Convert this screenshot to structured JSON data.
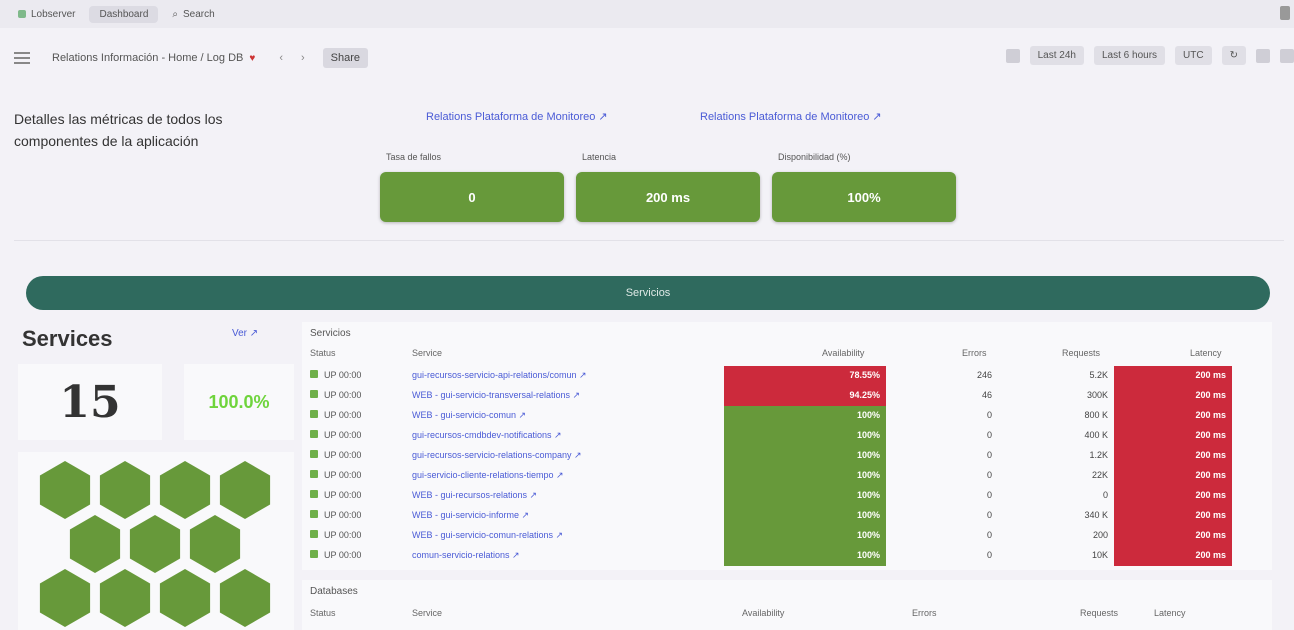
{
  "tabs": [
    {
      "label": "Lobserver",
      "active": false
    },
    {
      "label": "Dashboard",
      "active": true
    },
    {
      "label": "Search",
      "active": false
    }
  ],
  "toolbar": {
    "breadcrumb": "Relations Información - Home / Log DB",
    "favorite": "♥",
    "nav1": "‹",
    "nav2": "›",
    "button": "Share",
    "right_buttons": [
      "Last 24h",
      "Last 6 hours",
      "UTC",
      "↻"
    ]
  },
  "description": "Detalles las métricas de todos los componentes de la aplicación",
  "links": [
    "Relations Plataforma de Monitoreo ↗",
    "Relations Plataforma de Monitoreo ↗"
  ],
  "stats": [
    {
      "label": "Tasa de fallos",
      "value": "0"
    },
    {
      "label": "Latencia",
      "value": "200 ms"
    },
    {
      "label": "Disponibilidad (%)",
      "value": "100%"
    }
  ],
  "banner": "Servicios",
  "services": {
    "title": "Services",
    "link": "Ver ↗",
    "count": "15",
    "percent": "100.0%",
    "hex_count": 11
  },
  "table": {
    "title": "Servicios",
    "headers": [
      "Status",
      "Service",
      "Availability",
      "Errors",
      "Requests",
      "Latency"
    ],
    "rows": [
      {
        "status": "UP 00:00",
        "service": "gui-recursos-servicio-api-relations/comun ↗",
        "availability": "78.55%",
        "avail_color": "#cc2a3c",
        "errors": "246",
        "requests": "5.2K",
        "latency": "200 ms"
      },
      {
        "status": "UP 00:00",
        "service": "WEB - gui-servicio-transversal-relations ↗",
        "availability": "94.25%",
        "avail_color": "#cc2a3c",
        "errors": "46",
        "requests": "300K",
        "latency": "200 ms"
      },
      {
        "status": "UP 00:00",
        "service": "WEB - gui-servicio-comun ↗",
        "availability": "100%",
        "avail_color": "#67993a",
        "errors": "0",
        "requests": "800 K",
        "latency": "200 ms"
      },
      {
        "status": "UP 00:00",
        "service": "gui-recursos-cmdbdev-notifications ↗",
        "availability": "100%",
        "avail_color": "#67993a",
        "errors": "0",
        "requests": "400 K",
        "latency": "200 ms"
      },
      {
        "status": "UP 00:00",
        "service": "gui-recursos-servicio-relations-company ↗",
        "availability": "100%",
        "avail_color": "#67993a",
        "errors": "0",
        "requests": "1.2K",
        "latency": "200 ms"
      },
      {
        "status": "UP 00:00",
        "service": "gui-servicio-cliente-relations-tiempo ↗",
        "availability": "100%",
        "avail_color": "#67993a",
        "errors": "0",
        "requests": "22K",
        "latency": "200 ms"
      },
      {
        "status": "UP 00:00",
        "service": "WEB - gui-recursos-relations ↗",
        "availability": "100%",
        "avail_color": "#67993a",
        "errors": "0",
        "requests": "0",
        "latency": "200 ms"
      },
      {
        "status": "UP 00:00",
        "service": "WEB - gui-servicio-informe ↗",
        "availability": "100%",
        "avail_color": "#67993a",
        "errors": "0",
        "requests": "340 K",
        "latency": "200 ms"
      },
      {
        "status": "UP 00:00",
        "service": "WEB - gui-servicio-comun-relations ↗",
        "availability": "100%",
        "avail_color": "#67993a",
        "errors": "0",
        "requests": "200",
        "latency": "200 ms"
      },
      {
        "status": "UP 00:00",
        "service": "comun-servicio-relations ↗",
        "availability": "100%",
        "avail_color": "#67993a",
        "errors": "0",
        "requests": "10K",
        "latency": "200 ms"
      }
    ]
  },
  "table2": {
    "title": "Databases",
    "headers": [
      "Status",
      "Service",
      "Availability",
      "Errors",
      "Requests",
      "Latency"
    ]
  },
  "colors": {
    "ok_green": "#67993a",
    "error_red": "#cc2a3c",
    "banner_teal": "#2f6a5e",
    "link_blue": "#4a5bd6"
  }
}
